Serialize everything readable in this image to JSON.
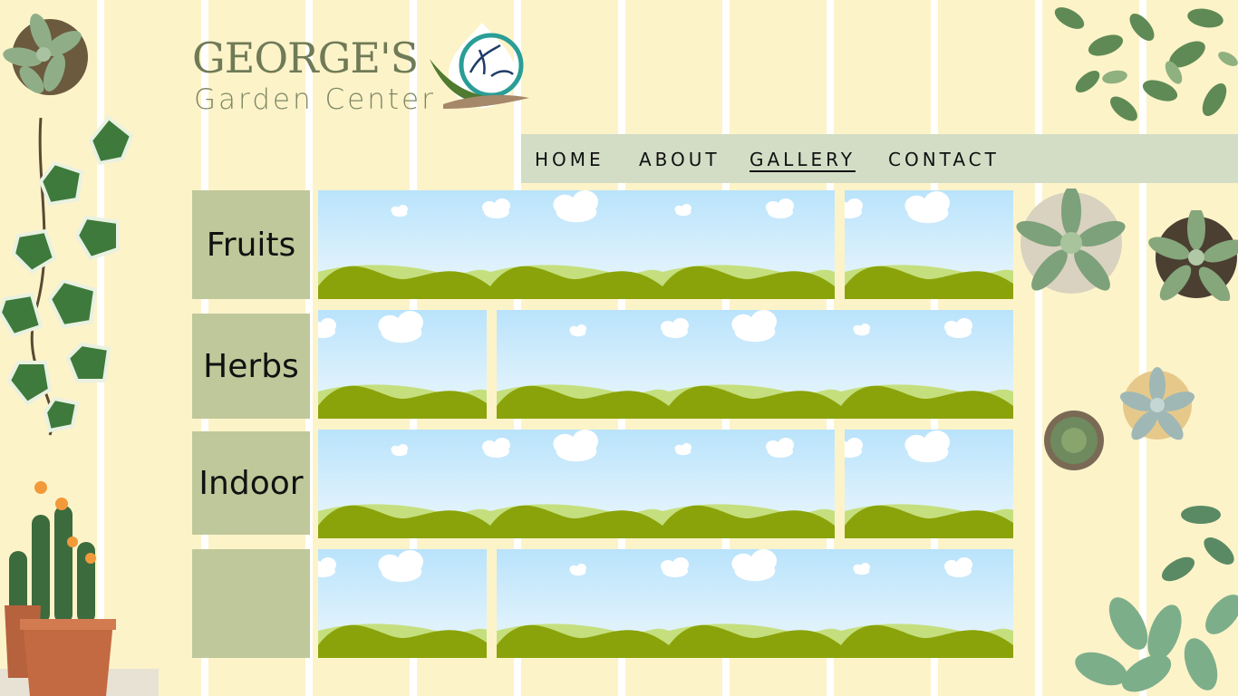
{
  "brand": {
    "name": "GEORGE'S",
    "subtitle": "Garden Center"
  },
  "nav": {
    "items": [
      {
        "label": "HOME"
      },
      {
        "label": "ABOUT"
      },
      {
        "label": "GALLERY"
      },
      {
        "label": "CONTACT"
      }
    ],
    "active": "GALLERY"
  },
  "gallery": {
    "categories": [
      {
        "label": "Fruits"
      },
      {
        "label": "Herbs"
      },
      {
        "label": "Indoor"
      },
      {
        "label": ""
      }
    ]
  },
  "colors": {
    "background": "#fdf3c9",
    "nav_bg": "#d3ddc6",
    "category_bg": "#bfc89a",
    "brand_text": "#6f7a56",
    "sky": "#c8e8fb",
    "hill_dark": "#8aa30a",
    "hill_light": "#c5df7e"
  },
  "icons": [
    "garden-logo-icon",
    "plant-decoration"
  ]
}
